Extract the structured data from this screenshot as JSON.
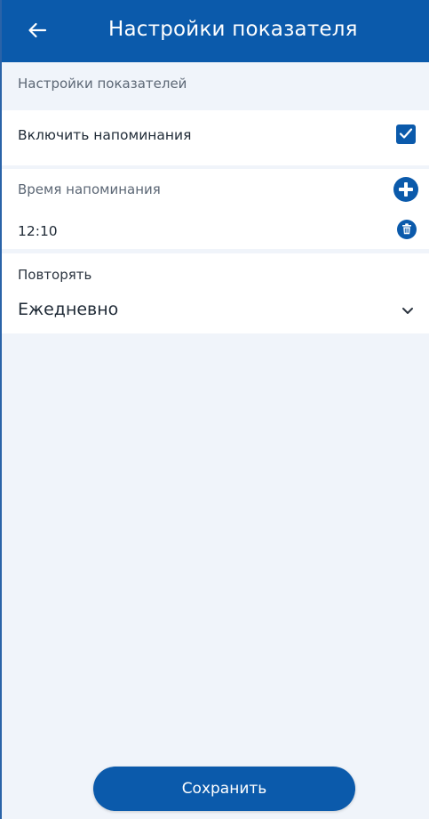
{
  "app_bar": {
    "title": "Настройки показателя",
    "back_icon": "arrow-left-icon"
  },
  "section": {
    "header": "Настройки показателей"
  },
  "reminders": {
    "label": "Включить напоминания",
    "enabled": true
  },
  "reminder_time": {
    "label": "Время напоминания",
    "times": [
      "12:10"
    ]
  },
  "repeat": {
    "label": "Повторять",
    "selected": "Ежедневно"
  },
  "actions": {
    "save_label": "Сохранить"
  },
  "colors": {
    "primary": "#0b5aab",
    "background": "#f0f4fa",
    "card": "#ffffff",
    "muted_text": "#5c6775"
  }
}
